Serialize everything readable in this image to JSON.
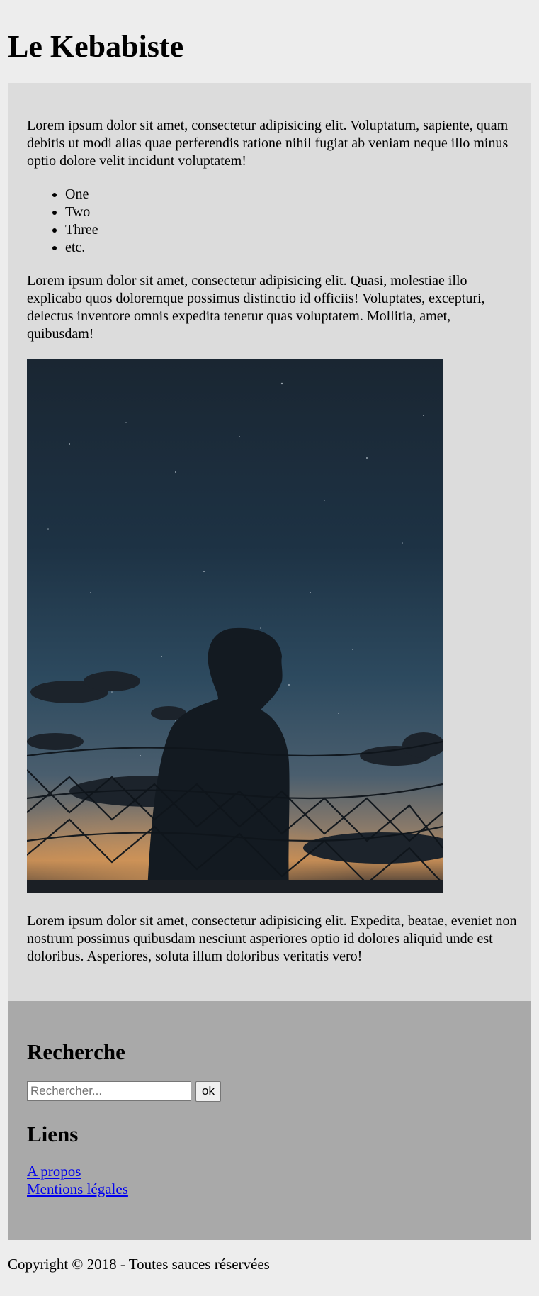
{
  "site": {
    "title": "Le Kebabiste"
  },
  "main": {
    "paragraph_1": "Lorem ipsum dolor sit amet, consectetur adipisicing elit. Voluptatum, sapiente, quam debitis ut modi alias quae perferendis ratione nihil fugiat ab veniam neque illo minus optio dolore velit incidunt voluptatem!",
    "list_items": [
      "One",
      "Two",
      "Three",
      "etc."
    ],
    "paragraph_2": "Lorem ipsum dolor sit amet, consectetur adipisicing elit. Quasi, molestiae illo explicabo quos doloremque possimus distinctio id officiis! Voluptates, excepturi, delectus inventore omnis expedita tenetur quas voluptatem. Mollitia, amet, quibusdam!",
    "paragraph_3": "Lorem ipsum dolor sit amet, consectetur adipisicing elit. Expedita, beatae, eveniet non nostrum possimus quibusdam nesciunt asperiores optio id dolores aliquid unde est doloribus. Asperiores, soluta illum doloribus veritatis vero!"
  },
  "sidebar": {
    "search_title": "Recherche",
    "search_placeholder": "Rechercher...",
    "search_value": "",
    "search_button": "ok",
    "links_title": "Liens",
    "links": [
      {
        "label": "A propos"
      },
      {
        "label": "Mentions légales"
      }
    ]
  },
  "footer": {
    "copyright": "Copyright © 2018 - Toutes sauces réservées"
  },
  "colors": {
    "page_background": "#ededed",
    "main_background": "#dcdcdc",
    "sidebar_background": "#a9a9a9",
    "link": "#0000ee"
  }
}
